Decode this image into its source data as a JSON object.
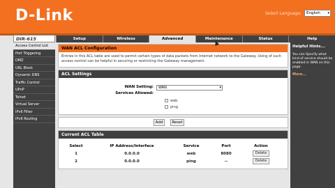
{
  "header": {
    "logo": "D-Link",
    "language_label": "Select Language:",
    "language_value": "English"
  },
  "model": "DIR-615",
  "tabs": [
    {
      "label": "Setup"
    },
    {
      "label": "Wireless"
    },
    {
      "label": "Advanced"
    },
    {
      "label": "Maintenance"
    },
    {
      "label": "Status"
    },
    {
      "label": "Help"
    }
  ],
  "sidebar": {
    "items": [
      {
        "label": "Access Control List"
      },
      {
        "label": "Port Triggering"
      },
      {
        "label": "DMZ"
      },
      {
        "label": "URL Block"
      },
      {
        "label": "Dynamic DNS"
      },
      {
        "label": "Traffic Control"
      },
      {
        "label": "UPnP"
      },
      {
        "label": "Telnet"
      },
      {
        "label": "Virtual Server"
      },
      {
        "label": "IPv6 Filter"
      },
      {
        "label": "IPv6 Routing"
      }
    ]
  },
  "acl_config": {
    "title": "WAN ACL Configuration",
    "text": "Entries in this ACL table are used to permit certain types of data packets from Internet network to the Gateway. Using of such access control can be helpful in securing or restricting the Gateway management."
  },
  "acl_settings": {
    "title": "ACL Settings",
    "wan_setting_label": "WAN Setting:",
    "wan_setting_value": "WAN",
    "services_label": "Services Allowed:",
    "services": [
      "web",
      "ping"
    ]
  },
  "buttons": {
    "add": "Add",
    "reset": "Reset"
  },
  "acl_table": {
    "title": "Current ACL Table",
    "columns": [
      "Select",
      "IP Address/Interface",
      "Service",
      "Port",
      "Action"
    ],
    "rows": [
      {
        "select": "1",
        "ip": "0.0.0.0",
        "service": "web",
        "port": "8080",
        "action": "Delete"
      },
      {
        "select": "2",
        "ip": "0.0.0.0",
        "service": "ping",
        "port": "--",
        "action": "Delete"
      }
    ]
  },
  "hints": {
    "title": "Helpful Hints...",
    "text": "You can Specify what kind of service should be enabled in WAN on this page.",
    "more": "More..."
  }
}
